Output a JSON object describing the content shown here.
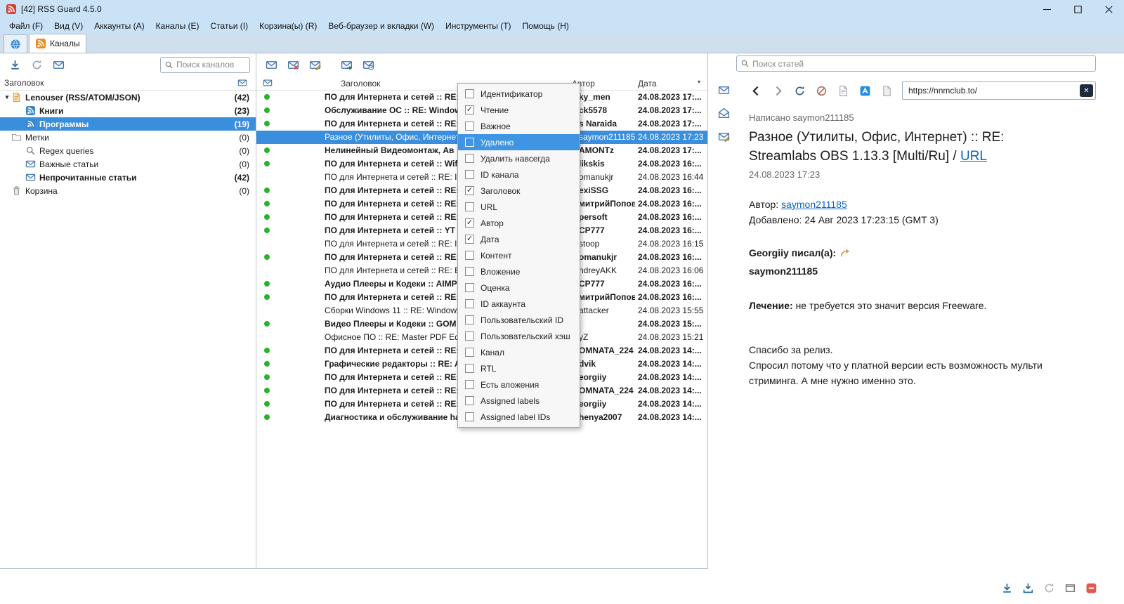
{
  "window": {
    "title": "[42] RSS Guard 4.5.0"
  },
  "menubar": {
    "items": [
      "Файл (F)",
      "Вид (V)",
      "Аккаунты (A)",
      "Каналы (E)",
      "Статьи (I)",
      "Корзина(ы) (R)",
      "Веб-браузер и вкладки (W)",
      "Инструменты (T)",
      "Помощь (H)"
    ]
  },
  "tabbar": {
    "feeds_tab": "Каналы"
  },
  "feeds_panel": {
    "toolbar_icons": [
      "download-icon",
      "refresh-icon",
      "mail-icon"
    ],
    "search_placeholder": "Поиск каналов",
    "column_header": "Заголовок",
    "items": [
      {
        "label": "Lenouser (RSS/ATOM/JSON)",
        "count": "(42)",
        "icon": "account-icon",
        "indent": 0,
        "bold": true,
        "expanded": true
      },
      {
        "label": "Книги",
        "count": "(23)",
        "icon": "feed-icon",
        "indent": 1,
        "bold": true
      },
      {
        "label": "Программы",
        "count": "(19)",
        "icon": "feed-icon",
        "indent": 1,
        "bold": true,
        "selected": true
      },
      {
        "label": "Метки",
        "count": "(0)",
        "icon": "folder-icon",
        "indent": 0
      },
      {
        "label": "Regex queries",
        "count": "(0)",
        "icon": "search-icon",
        "indent": 1
      },
      {
        "label": "Важные статьи",
        "count": "(0)",
        "icon": "mail-icon",
        "indent": 1
      },
      {
        "label": "Непрочитанные статьи",
        "count": "(42)",
        "icon": "mail-icon",
        "indent": 1,
        "bold": true
      },
      {
        "label": "Корзина",
        "count": "(0)",
        "icon": "trash-icon",
        "indent": 0
      }
    ]
  },
  "articles_panel": {
    "toolbar_icons": [
      "mail-icon",
      "mail-x-icon",
      "mail-pencil-icon",
      "gap",
      "mail-arrow-icon",
      "mail-clock-icon"
    ],
    "columns": {
      "title": "Заголовок",
      "author": "Автор",
      "date": "Дата"
    },
    "rows": [
      {
        "title": "ПО для Интернета и сетей :: RE: ",
        "author": "ky_men",
        "date": "24.08.2023 17:...",
        "unread": true
      },
      {
        "title": "Обслуживание ОС :: RE: Window",
        "author": "ck5578",
        "date": "24.08.2023 17:...",
        "unread": true
      },
      {
        "title": "ПО для Интернета и сетей :: RE: Im",
        "author": "s Naraida",
        "date": "24.08.2023 17:...",
        "unread": true
      },
      {
        "title": "Разное (Утилиты, Офис, Интернет) :: RE: Streamlabs OBS 1.13.3 [Multi/Ru]",
        "author": "saymon211185",
        "date": "24.08.2023 17:23",
        "unread": false,
        "selected": true
      },
      {
        "title": "Нелинейный Видеомонтаж, Ав",
        "author": "AMONTz",
        "date": "24.08.2023 17:...",
        "unread": true
      },
      {
        "title": "ПО для Интернета и сетей :: Wifi",
        "author": "likskis",
        "date": "24.08.2023 16:...",
        "unread": true
      },
      {
        "title": "ПО для Интернета и сетей :: RE: Im",
        "author": "omanukjr",
        "date": "24.08.2023 16:44",
        "unread": false
      },
      {
        "title": "ПО для Интернета и сетей :: RE: ",
        "author": "exiSSG",
        "date": "24.08.2023 16:...",
        "unread": true
      },
      {
        "title": "ПО для Интернета и сетей :: RE: ",
        "author": "митрийПопов",
        "date": "24.08.2023 16:...",
        "unread": true
      },
      {
        "title": "ПО для Интернета и сетей :: RE: ",
        "author": "persoft",
        "date": "24.08.2023 16:...",
        "unread": true
      },
      {
        "title": "ПО для Интернета и сетей :: YT D",
        "author": "CP777",
        "date": "24.08.2023 16:...",
        "unread": true
      },
      {
        "title": "ПО для Интернета и сетей :: RE: Im",
        "author": "stoop",
        "date": "24.08.2023 16:15",
        "unread": false
      },
      {
        "title": "ПО для Интернета и сетей :: RE: I",
        "author": "omanukjr",
        "date": "24.08.2023 16:...",
        "unread": true
      },
      {
        "title": "ПО для Интернета и сетей :: RE: By",
        "author": "ndreyAKK",
        "date": "24.08.2023 16:06",
        "unread": false
      },
      {
        "title": "Аудио Плееры и Кодеки :: AIMP ",
        "author": "CP777",
        "date": "24.08.2023 16:...",
        "unread": true
      },
      {
        "title": "ПО для Интернета и сетей :: RE: ",
        "author": "митрийПопов",
        "date": "24.08.2023 16:...",
        "unread": true
      },
      {
        "title": "Сборки Windows 11 :: RE: Windows",
        "author": "attacker",
        "date": "24.08.2023 15:55",
        "unread": false
      },
      {
        "title": "Видео Плееры и Кодеки :: GOM",
        "author": "",
        "date": "24.08.2023 15:...",
        "unread": true
      },
      {
        "title": "Офисное ПО :: RE: Master PDF Edit",
        "author": "yZ",
        "date": "24.08.2023 15:21",
        "unread": false
      },
      {
        "title": "ПО для Интернета и сетей :: RE: ",
        "author": "OMNATA_224",
        "date": "24.08.2023 14:...",
        "unread": true
      },
      {
        "title": "Графические редакторы :: RE: AC",
        "author": "dvik",
        "date": "24.08.2023 14:...",
        "unread": true
      },
      {
        "title": "ПО для Интернета и сетей :: RE: ",
        "author": "eorgiiy",
        "date": "24.08.2023 14:...",
        "unread": true
      },
      {
        "title": "ПО для Интернета и сетей :: RE: ",
        "author": "OMNATA_224",
        "date": "24.08.2023 14:...",
        "unread": true
      },
      {
        "title": "ПО для Интернета и сетей :: RE: ",
        "author": "eorgiiy",
        "date": "24.08.2023 14:...",
        "unread": true
      },
      {
        "title": "Диагностика и обслуживание ha",
        "author": "henya2007",
        "date": "24.08.2023 14:...",
        "unread": true
      }
    ]
  },
  "column_menu": {
    "items": [
      {
        "label": "Идентификатор",
        "checked": false
      },
      {
        "label": "Чтение",
        "checked": true
      },
      {
        "label": "Важное",
        "checked": false
      },
      {
        "label": "Удалено",
        "checked": false,
        "highlighted": true
      },
      {
        "label": "Удалить навсегда",
        "checked": false
      },
      {
        "label": "ID канала",
        "checked": false
      },
      {
        "label": "Заголовок",
        "checked": true
      },
      {
        "label": "URL",
        "checked": false
      },
      {
        "label": "Автор",
        "checked": true
      },
      {
        "label": "Дата",
        "checked": true
      },
      {
        "label": "Контент",
        "checked": false
      },
      {
        "label": "Вложение",
        "checked": false
      },
      {
        "label": "Оценка",
        "checked": false
      },
      {
        "label": "ID аккаунта",
        "checked": false
      },
      {
        "label": "Пользовательский ID",
        "checked": false
      },
      {
        "label": "Пользовательский хэш",
        "checked": false
      },
      {
        "label": "Канал",
        "checked": false
      },
      {
        "label": "RTL",
        "checked": false
      },
      {
        "label": "Есть вложения",
        "checked": false
      },
      {
        "label": "Assigned labels",
        "checked": false
      },
      {
        "label": "Assigned label IDs",
        "checked": false
      }
    ]
  },
  "view_panel": {
    "search_placeholder": "Поиск статей",
    "vert_icons": [
      "mail-icon",
      "mail-open-icon",
      "mail-pencil-icon"
    ],
    "browser_icons": [
      "back-icon",
      "forward-icon",
      "reload-icon",
      "stop-icon",
      "page-icon",
      "discover-icon",
      "file-icon"
    ],
    "bottom_icons": [
      "download-icon",
      "download-tray-icon",
      "reload-gray-icon",
      "window-icon",
      "adblock-icon"
    ],
    "browser": {
      "url": "https://nnmclub.to/"
    }
  },
  "article_view": {
    "written_by": "Написано saymon211185",
    "title_line1": "Разное (Утилиты, Офис, Интернет) :: RE:",
    "title_line2": "Streamlabs OBS 1.13.3 [Multi/Ru] / ",
    "title_link": "URL",
    "date": "24.08.2023 17:23",
    "author_label": "Автор:",
    "author": "saymon211185",
    "added": "Добавлено: 24 Авг 2023 17:23:15 (GMT 3)",
    "quote_header": "Georgiiy писал(а):",
    "quote_author": "saymon211185",
    "treatment_label": "Лечение:",
    "treatment_text": "не требуется это значит версия Freeware.",
    "thanks": "Спасибо за релиз.",
    "body": "Спросил потому что у платной версии есть возможность мульти стриминга. А мне нужно именно это."
  }
}
